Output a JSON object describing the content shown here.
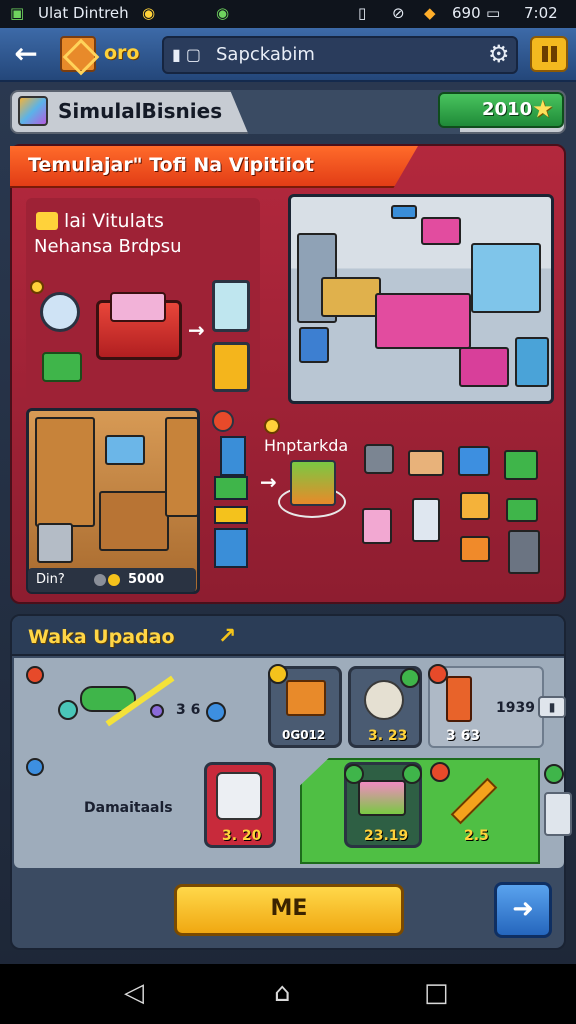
{
  "status_bar": {
    "app_name": "Ulat Dintreh",
    "battery_value": "690",
    "time": "7:02"
  },
  "header": {
    "coin_count": "oro",
    "search_text": "Sapckabim"
  },
  "title_bar": {
    "title": "SimulalBisnies",
    "budget_value": "2010"
  },
  "feature_panel": {
    "banner": "Temulajar\" Tofi Na Vipitiiot",
    "intro_line1": "lai Vitulats",
    "intro_line2": "Nehansa Brdpsu",
    "rack_label": "Hnptarkda",
    "price_label": "Din?",
    "price_value": "5000"
  },
  "upgrades": {
    "title": "Waka Upadao",
    "combo_value": "3 6",
    "card1_value": "0G012",
    "card2_value": "3. 23",
    "card3_value": "3 63",
    "side_value": "1939",
    "demand_label": "Damaitaals",
    "card4_value": "3. 20",
    "card5_value": "23.19",
    "card6_value": "2.5",
    "main_button": "ME"
  },
  "colors": {
    "accent_red": "#b3283d",
    "accent_yellow": "#ffd84a",
    "accent_blue": "#3d6aa8",
    "accent_green": "#4fbf44"
  }
}
